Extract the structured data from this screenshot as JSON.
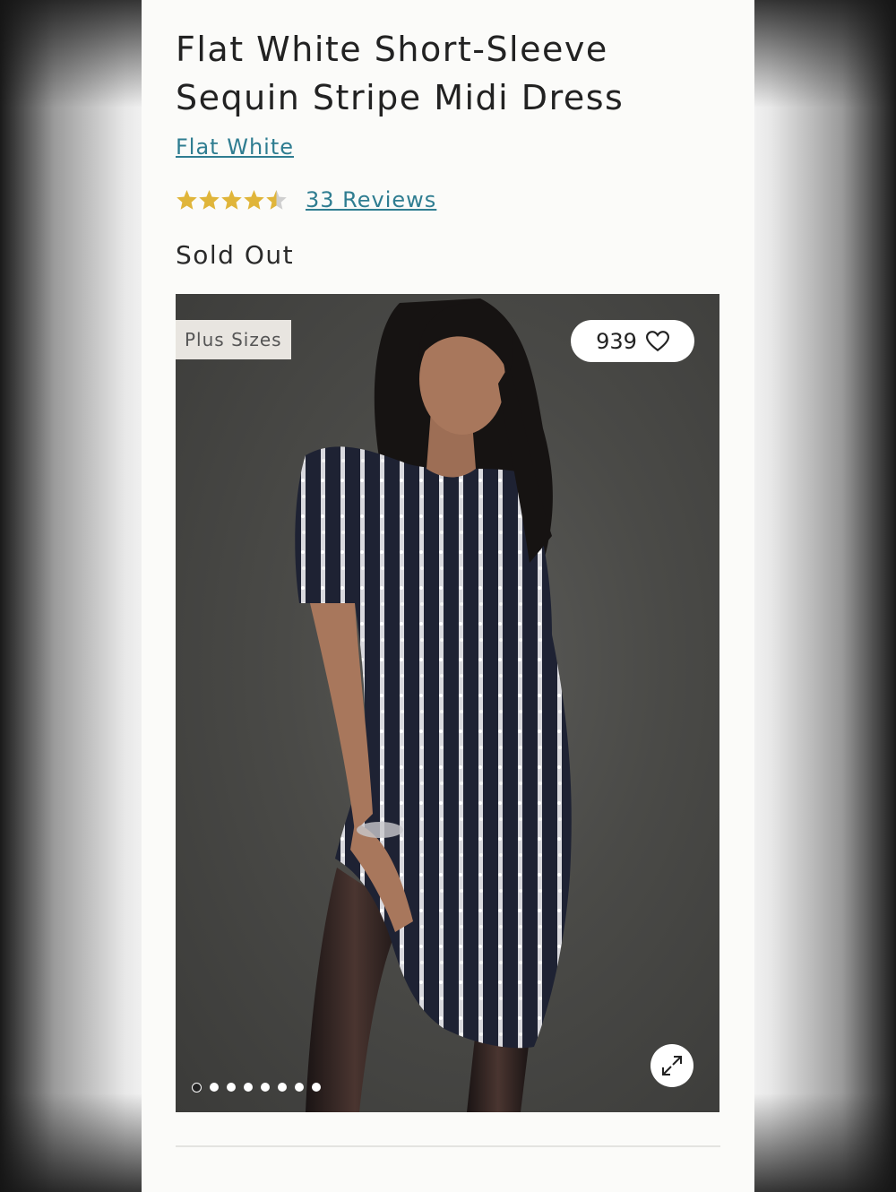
{
  "product": {
    "title": "Flat White Short-Sleeve Sequin Stripe Midi Dress",
    "brand": "Flat White",
    "rating": 4.5,
    "rating_max": 5,
    "reviews_label": "33 Reviews",
    "availability": "Sold Out"
  },
  "gallery": {
    "badge": "Plus Sizes",
    "favorites_count": "939",
    "image_count": 8,
    "active_index": 0
  },
  "colors": {
    "brand_link": "#2f7d91",
    "star": "#e0b53a"
  },
  "icons": [
    "star-icon",
    "heart-icon",
    "expand-icon"
  ]
}
